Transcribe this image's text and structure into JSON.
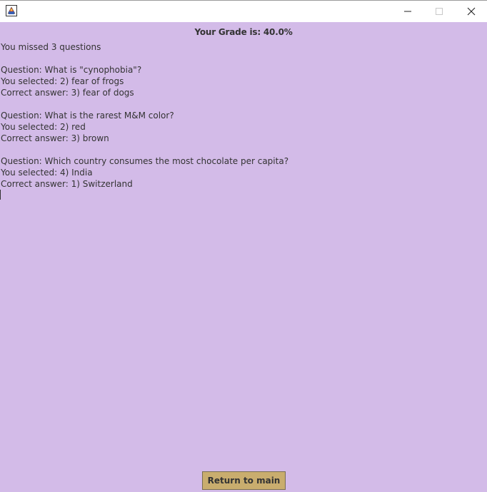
{
  "window": {
    "icon": "java-app-icon",
    "controls": {
      "minimize_icon": "minimize-icon",
      "maximize_icon": "maximize-icon",
      "close_icon": "close-icon"
    }
  },
  "header": {
    "grade_text": "Your Grade is: 40.0%"
  },
  "summary": {
    "missed_text": "You missed 3 questions"
  },
  "missed_questions": [
    {
      "question": "Question: What is \"cynophobia\"?",
      "selected": "You selected: 2) fear of frogs",
      "correct": "Correct answer: 3) fear of dogs"
    },
    {
      "question": "Question: What is the rarest M&M color?",
      "selected": "You selected: 2) red",
      "correct": "Correct answer: 3) brown"
    },
    {
      "question": "Question: Which country consumes the most chocolate per capita?",
      "selected": "You selected: 4) India",
      "correct": "Correct answer: 1) Switzerland"
    }
  ],
  "footer": {
    "return_label": "Return to main"
  },
  "colors": {
    "background": "#d3bbe8",
    "button": "#c9ad6e",
    "text": "#333333"
  }
}
